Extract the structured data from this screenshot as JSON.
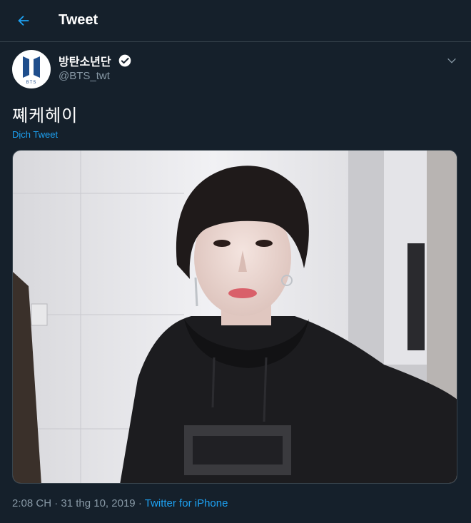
{
  "header": {
    "title": "Tweet",
    "back_icon": "back-arrow-icon"
  },
  "colors": {
    "background": "#15202b",
    "accent": "#1da1f2",
    "muted": "#8899a6",
    "divider": "#38444d"
  },
  "tweet": {
    "display_name": "방탄소년단",
    "handle": "@BTS_twt",
    "verified_icon": "verified-badge-icon",
    "avatar_logo_text": "BTS",
    "text": "쪠케헤이",
    "translate_label": "Dịch Tweet",
    "time": "2:08 CH",
    "separator": "·",
    "date": "31 thg 10, 2019",
    "source": "Twitter for iPhone"
  }
}
